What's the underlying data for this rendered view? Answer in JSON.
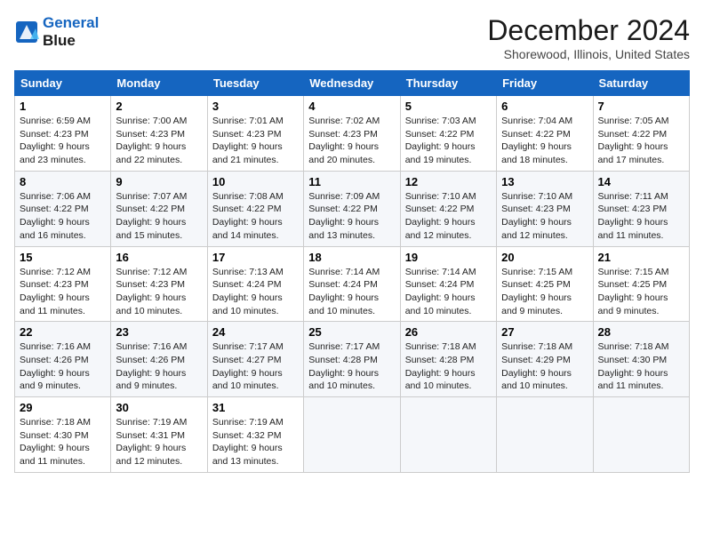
{
  "header": {
    "logo_line1": "General",
    "logo_line2": "Blue",
    "month_title": "December 2024",
    "location": "Shorewood, Illinois, United States"
  },
  "days_of_week": [
    "Sunday",
    "Monday",
    "Tuesday",
    "Wednesday",
    "Thursday",
    "Friday",
    "Saturday"
  ],
  "weeks": [
    [
      {
        "day": "1",
        "info": "Sunrise: 6:59 AM\nSunset: 4:23 PM\nDaylight: 9 hours\nand 23 minutes."
      },
      {
        "day": "2",
        "info": "Sunrise: 7:00 AM\nSunset: 4:23 PM\nDaylight: 9 hours\nand 22 minutes."
      },
      {
        "day": "3",
        "info": "Sunrise: 7:01 AM\nSunset: 4:23 PM\nDaylight: 9 hours\nand 21 minutes."
      },
      {
        "day": "4",
        "info": "Sunrise: 7:02 AM\nSunset: 4:23 PM\nDaylight: 9 hours\nand 20 minutes."
      },
      {
        "day": "5",
        "info": "Sunrise: 7:03 AM\nSunset: 4:22 PM\nDaylight: 9 hours\nand 19 minutes."
      },
      {
        "day": "6",
        "info": "Sunrise: 7:04 AM\nSunset: 4:22 PM\nDaylight: 9 hours\nand 18 minutes."
      },
      {
        "day": "7",
        "info": "Sunrise: 7:05 AM\nSunset: 4:22 PM\nDaylight: 9 hours\nand 17 minutes."
      }
    ],
    [
      {
        "day": "8",
        "info": "Sunrise: 7:06 AM\nSunset: 4:22 PM\nDaylight: 9 hours\nand 16 minutes."
      },
      {
        "day": "9",
        "info": "Sunrise: 7:07 AM\nSunset: 4:22 PM\nDaylight: 9 hours\nand 15 minutes."
      },
      {
        "day": "10",
        "info": "Sunrise: 7:08 AM\nSunset: 4:22 PM\nDaylight: 9 hours\nand 14 minutes."
      },
      {
        "day": "11",
        "info": "Sunrise: 7:09 AM\nSunset: 4:22 PM\nDaylight: 9 hours\nand 13 minutes."
      },
      {
        "day": "12",
        "info": "Sunrise: 7:10 AM\nSunset: 4:22 PM\nDaylight: 9 hours\nand 12 minutes."
      },
      {
        "day": "13",
        "info": "Sunrise: 7:10 AM\nSunset: 4:23 PM\nDaylight: 9 hours\nand 12 minutes."
      },
      {
        "day": "14",
        "info": "Sunrise: 7:11 AM\nSunset: 4:23 PM\nDaylight: 9 hours\nand 11 minutes."
      }
    ],
    [
      {
        "day": "15",
        "info": "Sunrise: 7:12 AM\nSunset: 4:23 PM\nDaylight: 9 hours\nand 11 minutes."
      },
      {
        "day": "16",
        "info": "Sunrise: 7:12 AM\nSunset: 4:23 PM\nDaylight: 9 hours\nand 10 minutes."
      },
      {
        "day": "17",
        "info": "Sunrise: 7:13 AM\nSunset: 4:24 PM\nDaylight: 9 hours\nand 10 minutes."
      },
      {
        "day": "18",
        "info": "Sunrise: 7:14 AM\nSunset: 4:24 PM\nDaylight: 9 hours\nand 10 minutes."
      },
      {
        "day": "19",
        "info": "Sunrise: 7:14 AM\nSunset: 4:24 PM\nDaylight: 9 hours\nand 10 minutes."
      },
      {
        "day": "20",
        "info": "Sunrise: 7:15 AM\nSunset: 4:25 PM\nDaylight: 9 hours\nand 9 minutes."
      },
      {
        "day": "21",
        "info": "Sunrise: 7:15 AM\nSunset: 4:25 PM\nDaylight: 9 hours\nand 9 minutes."
      }
    ],
    [
      {
        "day": "22",
        "info": "Sunrise: 7:16 AM\nSunset: 4:26 PM\nDaylight: 9 hours\nand 9 minutes."
      },
      {
        "day": "23",
        "info": "Sunrise: 7:16 AM\nSunset: 4:26 PM\nDaylight: 9 hours\nand 9 minutes."
      },
      {
        "day": "24",
        "info": "Sunrise: 7:17 AM\nSunset: 4:27 PM\nDaylight: 9 hours\nand 10 minutes."
      },
      {
        "day": "25",
        "info": "Sunrise: 7:17 AM\nSunset: 4:28 PM\nDaylight: 9 hours\nand 10 minutes."
      },
      {
        "day": "26",
        "info": "Sunrise: 7:18 AM\nSunset: 4:28 PM\nDaylight: 9 hours\nand 10 minutes."
      },
      {
        "day": "27",
        "info": "Sunrise: 7:18 AM\nSunset: 4:29 PM\nDaylight: 9 hours\nand 10 minutes."
      },
      {
        "day": "28",
        "info": "Sunrise: 7:18 AM\nSunset: 4:30 PM\nDaylight: 9 hours\nand 11 minutes."
      }
    ],
    [
      {
        "day": "29",
        "info": "Sunrise: 7:18 AM\nSunset: 4:30 PM\nDaylight: 9 hours\nand 11 minutes."
      },
      {
        "day": "30",
        "info": "Sunrise: 7:19 AM\nSunset: 4:31 PM\nDaylight: 9 hours\nand 12 minutes."
      },
      {
        "day": "31",
        "info": "Sunrise: 7:19 AM\nSunset: 4:32 PM\nDaylight: 9 hours\nand 13 minutes."
      },
      null,
      null,
      null,
      null
    ]
  ]
}
